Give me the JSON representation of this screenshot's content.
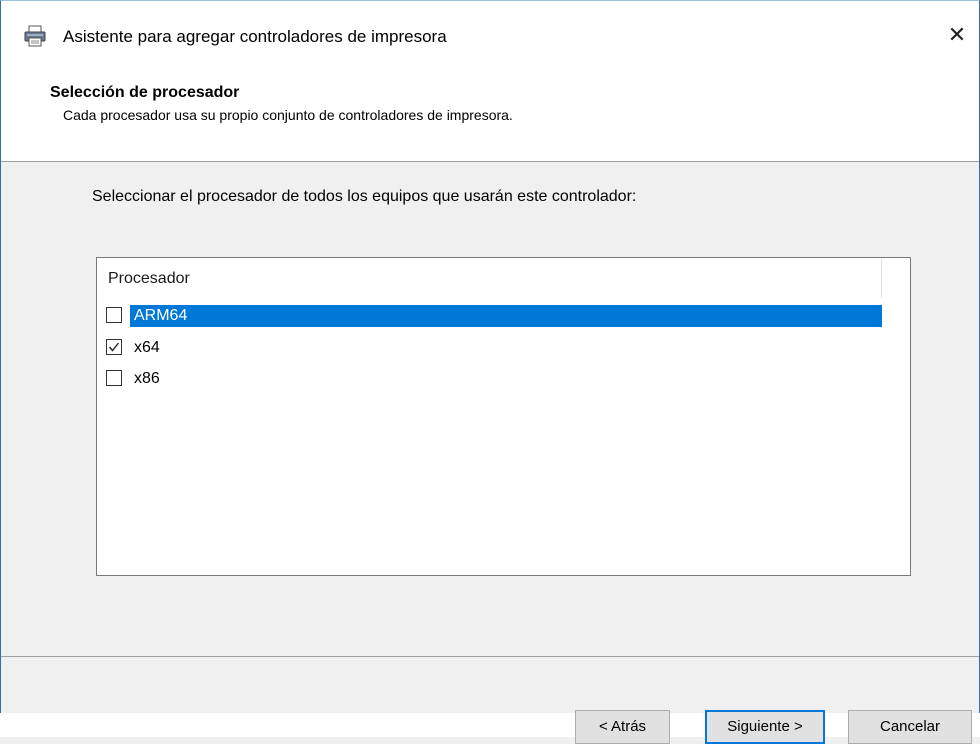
{
  "window": {
    "title": "Asistente para agregar controladores de impresora",
    "close_glyph": "✕"
  },
  "header": {
    "title": "Selección de procesador",
    "subtitle": "Cada procesador usa su propio conjunto de controladores de impresora."
  },
  "main": {
    "instruction": "Seleccionar el procesador de todos los equipos que usarán este controlador:",
    "list": {
      "column_header": "Procesador",
      "items": [
        {
          "label": "ARM64",
          "checked": false,
          "selected": true
        },
        {
          "label": "x64",
          "checked": true,
          "selected": false
        },
        {
          "label": "x86",
          "checked": false,
          "selected": false
        }
      ]
    }
  },
  "buttons": {
    "back": "< Atrás",
    "next": "Siguiente >",
    "cancel": "Cancelar"
  },
  "colors": {
    "accent": "#0078d7",
    "selection_text": "#ffffff"
  },
  "icons": {
    "title": "printer-icon",
    "close": "close-icon",
    "check": "checkmark-icon"
  }
}
